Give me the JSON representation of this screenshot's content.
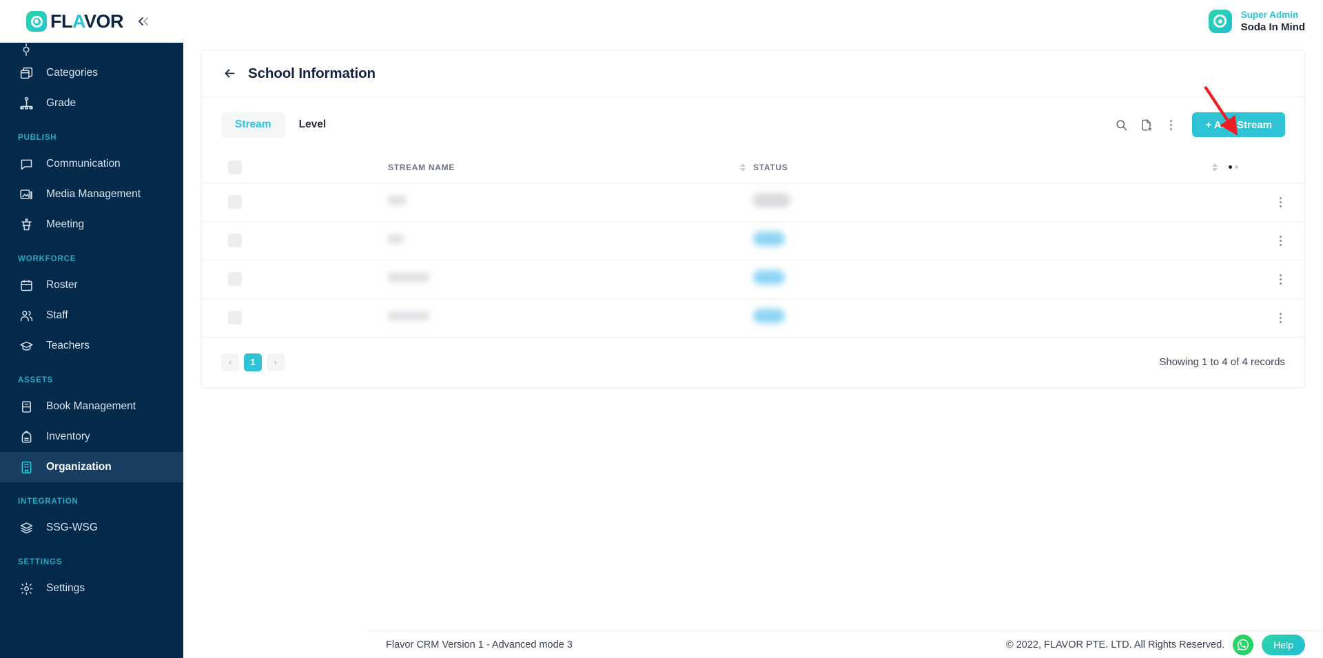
{
  "brand": {
    "logo_text_part1": "FL",
    "logo_text_accent": "A",
    "logo_text_part2": "VOR",
    "logo_icon": "flavor-ring-logo",
    "accent_color": "#2ec4d6",
    "sidebar_color": "#042a4b",
    "collapse_icon": "double-chevron-left-icon"
  },
  "header": {
    "user_role": "Super Admin",
    "user_name": "Soda In Mind",
    "avatar_icon": "ring-avatar"
  },
  "sidebar": {
    "partial_item": {
      "label": "",
      "icon": "partial-cut-icon"
    },
    "items": [
      {
        "label": "Categories",
        "icon": "categories-icon",
        "active": false
      },
      {
        "label": "Grade",
        "icon": "grade-hierarchy-icon",
        "active": false
      }
    ],
    "groups": [
      {
        "title": "PUBLISH",
        "items": [
          {
            "label": "Communication",
            "icon": "chat-bubble-icon",
            "active": false
          },
          {
            "label": "Media Management",
            "icon": "media-image-icon",
            "active": false
          },
          {
            "label": "Meeting",
            "icon": "podium-icon",
            "active": false
          }
        ]
      },
      {
        "title": "WORKFORCE",
        "items": [
          {
            "label": "Roster",
            "icon": "calendar-icon",
            "active": false
          },
          {
            "label": "Staff",
            "icon": "users-icon",
            "active": false
          },
          {
            "label": "Teachers",
            "icon": "graduation-cap-icon",
            "active": false
          }
        ]
      },
      {
        "title": "ASSETS",
        "items": [
          {
            "label": "Book Management",
            "icon": "book-icon",
            "active": false
          },
          {
            "label": "Inventory",
            "icon": "backpack-icon",
            "active": false
          },
          {
            "label": "Organization",
            "icon": "building-icon",
            "active": true
          }
        ]
      },
      {
        "title": "INTEGRATION",
        "items": [
          {
            "label": "SSG-WSG",
            "icon": "layers-icon",
            "active": false
          }
        ]
      },
      {
        "title": "SETTINGS",
        "items": [
          {
            "label": "Settings",
            "icon": "gear-icon",
            "active": false
          }
        ]
      }
    ]
  },
  "page": {
    "title": "School Information",
    "back_icon": "arrow-left-icon"
  },
  "tabs": [
    {
      "label": "Stream",
      "active": true
    },
    {
      "label": "Level",
      "active": false
    }
  ],
  "toolbar": {
    "search_icon": "search-icon",
    "export_icon": "document-add-icon",
    "more_icon": "more-vertical-icon",
    "add_button_label": "+ Add Stream"
  },
  "table": {
    "columns": [
      {
        "key": "checkbox",
        "label": ""
      },
      {
        "key": "stream_name",
        "label": "STREAM NAME",
        "sortable": true
      },
      {
        "key": "status",
        "label": "STATUS",
        "sortable": true
      }
    ],
    "header_indicator_dots": 2,
    "rows": [
      {
        "checkbox": false,
        "stream_name": "",
        "stream_name_width": 26,
        "status": "",
        "status_width": 54,
        "status_variant": "grey",
        "actions_icon": "more-vertical-icon"
      },
      {
        "checkbox": false,
        "stream_name": "",
        "stream_name_width": 22,
        "status": "",
        "status_width": 46,
        "status_variant": "blue",
        "actions_icon": "more-vertical-icon"
      },
      {
        "checkbox": false,
        "stream_name": "",
        "stream_name_width": 60,
        "status": "",
        "status_width": 46,
        "status_variant": "blue",
        "actions_icon": "more-vertical-icon"
      },
      {
        "checkbox": false,
        "stream_name": "",
        "stream_name_width": 60,
        "status": "",
        "status_width": 46,
        "status_variant": "blue",
        "actions_icon": "more-vertical-icon"
      }
    ]
  },
  "pagination": {
    "prev_label": "‹",
    "pages": [
      "1"
    ],
    "current_page": "1",
    "next_label": "›",
    "records_text": "Showing 1 to 4 of 4 records"
  },
  "footer": {
    "version_text": "Flavor CRM Version 1 - Advanced mode 3",
    "copyright": "© 2022, FLAVOR PTE. LTD. All Rights Reserved.",
    "whatsapp_icon": "whatsapp-icon",
    "help_label": "Help"
  },
  "annotation": {
    "arrow_color": "#ee1c25",
    "target": "add-stream-button"
  }
}
